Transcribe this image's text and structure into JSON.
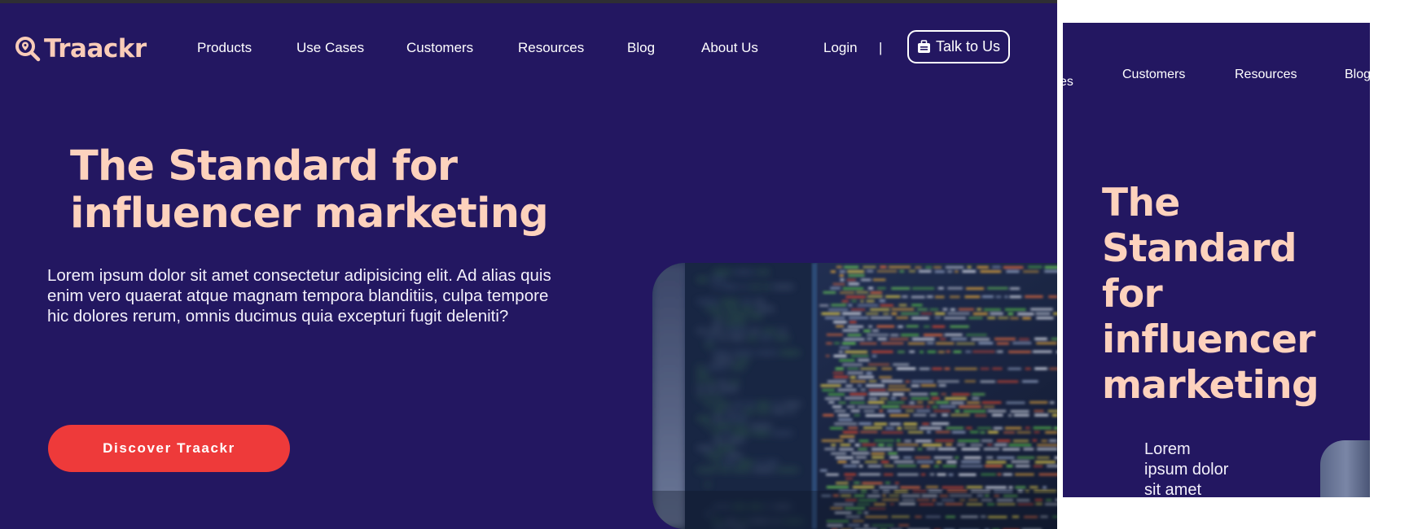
{
  "brand": {
    "name": "Traackr"
  },
  "nav": {
    "items": [
      "Products",
      "Use Cases",
      "Customers",
      "Resources",
      "Blog",
      "About Us"
    ],
    "login": "Login",
    "separator": "|",
    "cta": "Talk to Us"
  },
  "hero": {
    "headline_line1": "The Standard for",
    "headline_line2": "influencer marketing",
    "body": "Lorem ipsum dolor sit amet consectetur adipisicing elit. Ad alias quis enim vero quaerat atque magnam tempora blanditiis, culpa tempore hic dolores rerum, omnis ducimus quia excepturi fugit deleniti?",
    "cta": "Discover Traackr"
  },
  "mobile_preview": {
    "nav_partial": "es",
    "nav_items": [
      "Customers",
      "Resources",
      "Blog"
    ],
    "headline_words": [
      "The",
      "Standard",
      "for",
      "influencer",
      "marketing"
    ],
    "body_lines": [
      "Lorem",
      "ipsum dolor",
      "sit amet"
    ]
  },
  "colors": {
    "background": "#231761",
    "headline": "#fdd2bd",
    "cta": "#ee3a3a",
    "text": "#ffffff"
  },
  "icons": {
    "logo": "magnifier-pin-icon",
    "talk": "briefcase-icon"
  }
}
